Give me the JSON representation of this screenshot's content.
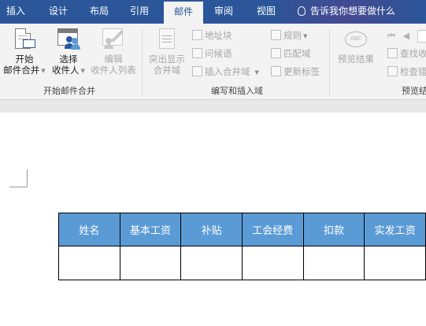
{
  "tabs": [
    {
      "label": "插入",
      "active": false
    },
    {
      "label": "设计",
      "active": false
    },
    {
      "label": "布局",
      "active": false
    },
    {
      "label": "引用",
      "active": false
    },
    {
      "label": "邮件",
      "active": true
    },
    {
      "label": "审阅",
      "active": false
    },
    {
      "label": "视图",
      "active": false
    }
  ],
  "tell_me": "告诉我你想要做什么",
  "ribbon": {
    "start_mail_merge": {
      "line1": "开始",
      "line2": "邮件合并"
    },
    "select_recipients": {
      "line1": "选择",
      "line2": "收件人"
    },
    "edit_recipients": {
      "line1": "编辑",
      "line2": "收件人列表"
    },
    "group1_label": "开始邮件合并",
    "highlight_fields": {
      "line1": "突出显示",
      "line2": "合并域"
    },
    "address_block": "地址块",
    "greeting_line": "问候语",
    "insert_merge_field": "插入合并域",
    "rules": "规则",
    "match_fields": "匹配域",
    "update_labels": "更新标签",
    "group2_label": "编写和插入域",
    "preview_results": "预览结果",
    "find_recipient": "查找收",
    "check_errors": "检查错",
    "group3_label": "预览结"
  },
  "table": {
    "headers": [
      "姓名",
      "基本工资",
      "补贴",
      "工会经费",
      "扣款",
      "实发工资"
    ],
    "rows": [
      [
        "",
        "",
        "",
        "",
        "",
        ""
      ]
    ]
  },
  "colors": {
    "tab_bar": "#2b579a",
    "ribbon_bg": "#f3f3f3",
    "table_header": "#5b9bd5"
  }
}
